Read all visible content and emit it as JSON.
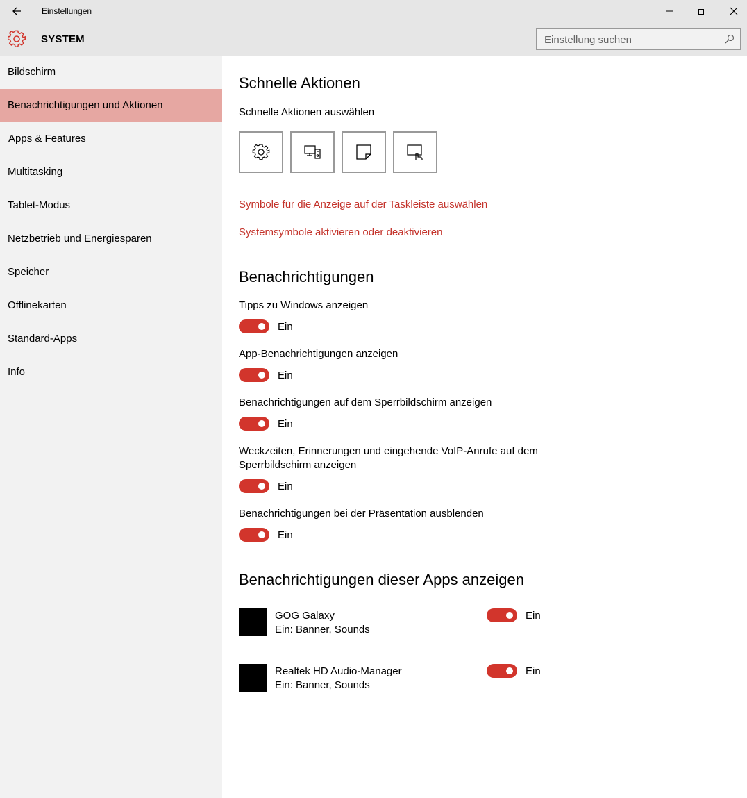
{
  "window": {
    "title": "Einstellungen"
  },
  "header": {
    "title": "SYSTEM",
    "search_placeholder": "Einstellung suchen"
  },
  "sidebar": {
    "items": [
      {
        "label": "Bildschirm"
      },
      {
        "label": "Benachrichtigungen und Aktionen",
        "active": true
      },
      {
        "label": "Apps & Features"
      },
      {
        "label": "Multitasking"
      },
      {
        "label": "Tablet-Modus"
      },
      {
        "label": "Netzbetrieb und Energiesparen"
      },
      {
        "label": "Speicher"
      },
      {
        "label": "Offlinekarten"
      },
      {
        "label": "Standard-Apps"
      },
      {
        "label": "Info"
      }
    ]
  },
  "quick_actions": {
    "heading": "Schnelle Aktionen",
    "subheading": "Schnelle Aktionen auswählen",
    "tiles": [
      "gear-icon",
      "project-icon",
      "note-icon",
      "tablet-mode-icon"
    ],
    "link_taskbar": "Symbole für die Anzeige auf der Taskleiste auswählen",
    "link_system": "Systemsymbole aktivieren oder deaktivieren"
  },
  "notifications": {
    "heading": "Benachrichtigungen",
    "settings": [
      {
        "label": "Tipps zu Windows anzeigen",
        "state": "Ein"
      },
      {
        "label": "App-Benachrichtigungen anzeigen",
        "state": "Ein"
      },
      {
        "label": "Benachrichtigungen auf dem Sperrbildschirm anzeigen",
        "state": "Ein"
      },
      {
        "label": "Weckzeiten, Erinnerungen und eingehende VoIP-Anrufe auf dem Sperrbildschirm anzeigen",
        "state": "Ein"
      },
      {
        "label": "Benachrichtigungen bei der Präsentation ausblenden",
        "state": "Ein"
      }
    ]
  },
  "apps": {
    "heading": "Benachrichtigungen dieser Apps anzeigen",
    "list": [
      {
        "name": "GOG Galaxy",
        "detail": "Ein: Banner, Sounds",
        "state": "Ein"
      },
      {
        "name": "Realtek HD Audio-Manager",
        "detail": "Ein: Banner, Sounds",
        "state": "Ein"
      }
    ]
  },
  "colors": {
    "accent": "#d2352c",
    "link": "#c4332b",
    "active_nav": "#e6a7a2",
    "sidebar_bg": "#f2f2f2",
    "titlebar_bg": "#e6e6e6"
  }
}
